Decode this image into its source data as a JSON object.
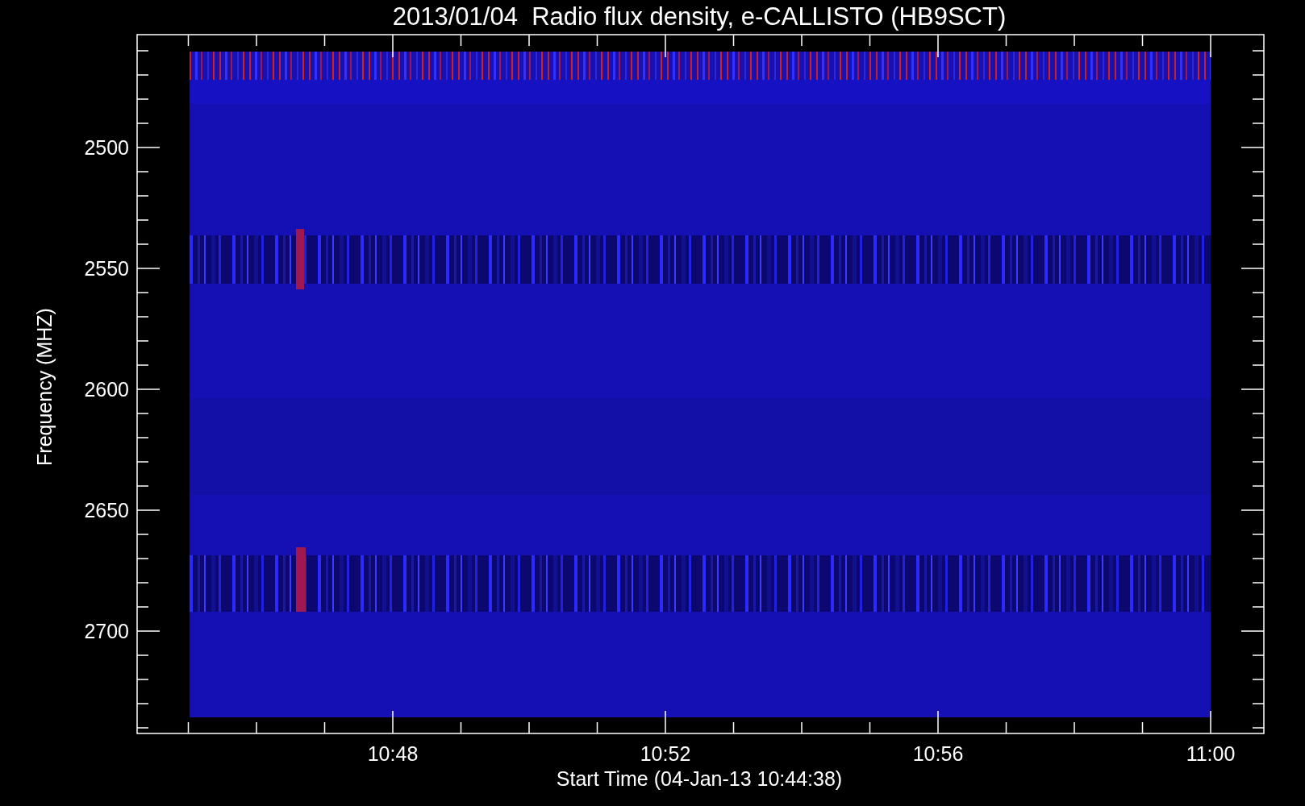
{
  "title": "2013/01/04  Radio flux density, e-CALLISTO (HB9SCT)",
  "y_axis": {
    "label": "Frequency (MHZ)",
    "ticks": [
      "2500",
      "2550",
      "2600",
      "2650",
      "2700"
    ]
  },
  "x_axis": {
    "label": "Start Time (04-Jan-13 10:44:38)",
    "ticks": [
      "10:48",
      "10:52",
      "10:56",
      "11:00"
    ]
  }
}
